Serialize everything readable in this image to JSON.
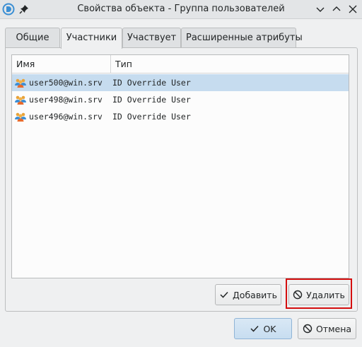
{
  "window": {
    "title": "Свойства объекта - Группа пользователей"
  },
  "tabs": [
    {
      "label": "Общие",
      "active": false
    },
    {
      "label": "Участники",
      "active": true
    },
    {
      "label": "Участвует",
      "active": false
    },
    {
      "label": "Расширенные  атрибуты",
      "active": false
    }
  ],
  "members": {
    "columns": [
      "Имя",
      "Тип"
    ],
    "rows": [
      {
        "name": "user500@win.srv",
        "type": "ID Override User",
        "selected": true
      },
      {
        "name": "user498@win.srv",
        "type": "ID Override User",
        "selected": false
      },
      {
        "name": "user496@win.srv",
        "type": "ID Override User",
        "selected": false
      }
    ],
    "row_icon": "users-icon"
  },
  "buttons": {
    "add": "Добавить",
    "remove": "Удалить",
    "ok": "OK",
    "cancel": "Отмена"
  },
  "colors": {
    "selection": "#c6dcef",
    "highlight": "#d40e0e",
    "ok_accent": "#c7ddf0"
  }
}
